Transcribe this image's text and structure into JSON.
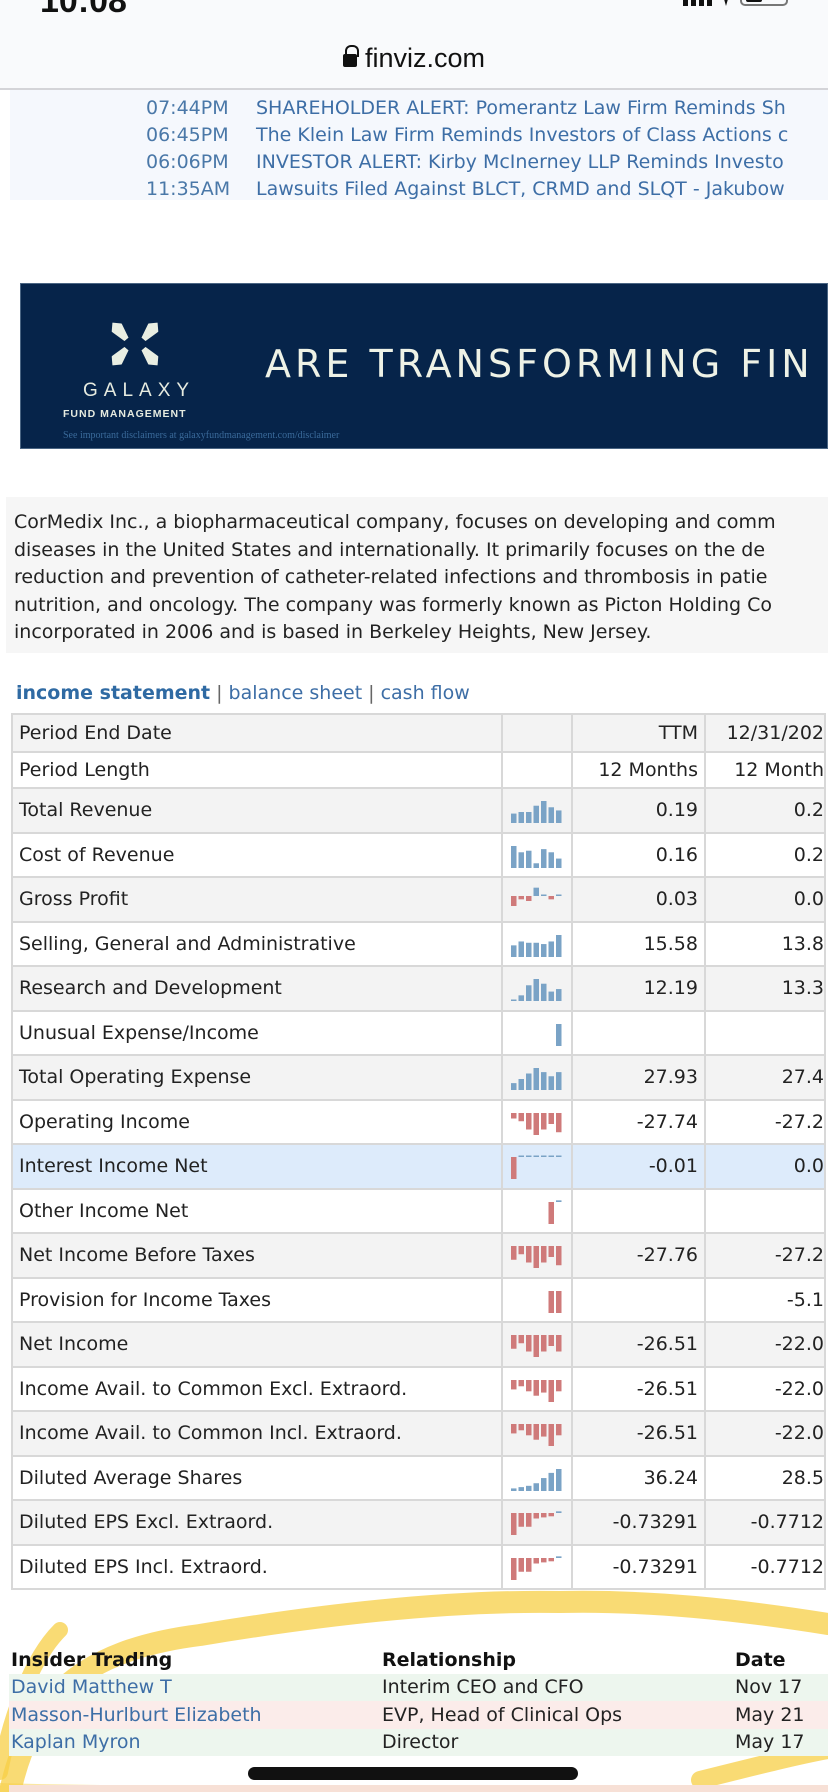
{
  "browser": {
    "url": "finviz.com"
  },
  "news": [
    {
      "time": "07:44PM",
      "title": "SHAREHOLDER ALERT: Pomerantz Law Firm Reminds Sh"
    },
    {
      "time": "06:45PM",
      "title": "The Klein Law Firm Reminds Investors of Class Actions c"
    },
    {
      "time": "06:06PM",
      "title": "INVESTOR ALERT: Kirby McInerney LLP Reminds Investo"
    },
    {
      "time": "11:35AM",
      "title": "Lawsuits Filed Against BLCT, CRMD and SLQT - Jakubow"
    }
  ],
  "ad": {
    "brand": "GALAXY",
    "sub": "FUND MANAGEMENT",
    "headline": "ARE TRANSFORMING FIN",
    "disclaimer": "See important disclaimers at galaxyfundmanagement.com/disclaimer",
    "background": "#06244a"
  },
  "description": [
    "CorMedix Inc., a biopharmaceutical company, focuses on developing and comm",
    "diseases in the United States and internationally. It primarily focuses on the de",
    "reduction and prevention of catheter-related infections and thrombosis in patie",
    "nutrition, and oncology. The company was formerly known as Picton Holding Co",
    "incorporated in 2006 and is based in Berkeley Heights, New Jersey."
  ],
  "statement_tabs": {
    "active": "income statement",
    "others": [
      "balance sheet",
      "cash flow"
    ],
    "separator": "|"
  },
  "financials": {
    "colors": {
      "positive": "#7aa3c6",
      "negative": "#cf7a7a"
    },
    "header": {
      "label": "Period End Date",
      "col1": "TTM",
      "col2": "12/31/202"
    },
    "period": {
      "label": "Period Length",
      "col1": "12 Months",
      "col2": "12 Month"
    },
    "rows": [
      {
        "label": "Total Revenue",
        "ttm": "0.19",
        "prev": "0.2",
        "spark": [
          3,
          3.5,
          3.5,
          5.5,
          7,
          5,
          4
        ]
      },
      {
        "label": "Cost of Revenue",
        "ttm": "0.16",
        "prev": "0.2",
        "spark": [
          7,
          5,
          5.5,
          1.5,
          6,
          5,
          3
        ]
      },
      {
        "label": "Gross Profit",
        "ttm": "0.03",
        "prev": "0.0",
        "spark": [
          -3,
          -1,
          -1.5,
          2.5,
          0.3,
          -1,
          0.3
        ]
      },
      {
        "label": "Selling, General and Administrative",
        "ttm": "15.58",
        "prev": "13.8",
        "spark": [
          4.5,
          6,
          5.5,
          5.5,
          5,
          6,
          8.5
        ]
      },
      {
        "label": "Research and Development",
        "ttm": "12.19",
        "prev": "13.3",
        "spark": [
          0.3,
          1.8,
          5,
          7,
          5.5,
          3,
          3.8
        ]
      },
      {
        "label": "Unusual Expense/Income",
        "ttm": "",
        "prev": "",
        "spark": [
          8
        ]
      },
      {
        "label": "Total Operating Expense",
        "ttm": "27.93",
        "prev": "27.4",
        "spark": [
          2.5,
          4,
          6,
          8,
          6.5,
          5,
          6.5
        ]
      },
      {
        "label": "Operating Income",
        "ttm": "-27.74",
        "prev": "-27.2",
        "spark": [
          -1,
          -1.5,
          -3,
          -4,
          -3,
          -2,
          -3.5
        ]
      },
      {
        "label": "Interest Income Net",
        "ttm": "-0.01",
        "prev": "0.0",
        "spark": [
          -4,
          0.2,
          0.2,
          0.2,
          0.2,
          0.2,
          0.2
        ]
      },
      {
        "label": "Other Income Net",
        "ttm": "",
        "prev": "",
        "spark": [
          null,
          -4,
          0.3
        ]
      },
      {
        "label": "Net Income Before Taxes",
        "ttm": "-27.76",
        "prev": "-27.2",
        "spark": [
          -2.5,
          -1.5,
          -3,
          -4,
          -3,
          -2,
          -3.5
        ]
      },
      {
        "label": "Provision for Income Taxes",
        "ttm": "",
        "prev": "-5.1",
        "spark": [
          null,
          null,
          null,
          null,
          null,
          -4,
          -4
        ]
      },
      {
        "label": "Net Income",
        "ttm": "-26.51",
        "prev": "-22.0",
        "spark": [
          -2.5,
          -1.5,
          -3,
          -4,
          -3,
          -2,
          -3
        ]
      },
      {
        "label": "Income Avail. to Common Excl. Extraord.",
        "ttm": "-26.51",
        "prev": "-22.0",
        "spark": [
          -1.5,
          -1,
          -1.8,
          -2.5,
          -2,
          -3.5,
          -1.8
        ]
      },
      {
        "label": "Income Avail. to Common Incl. Extraord.",
        "ttm": "-26.51",
        "prev": "-22.0",
        "spark": [
          -1.5,
          -1,
          -1.8,
          -2.5,
          -2,
          -3.5,
          -1.8
        ]
      },
      {
        "label": "Diluted Average Shares",
        "ttm": "36.24",
        "prev": "28.5",
        "spark": [
          1,
          1.5,
          2,
          3,
          5,
          7,
          8.5
        ]
      },
      {
        "label": "Diluted EPS Excl. Extraord.",
        "ttm": "-0.73291",
        "prev": "-0.7712",
        "spark": [
          -4,
          -2.5,
          -2.5,
          -1,
          -0.8,
          -0.6,
          0.3
        ]
      },
      {
        "label": "Diluted EPS Incl. Extraord.",
        "ttm": "-0.73291",
        "prev": "-0.7712",
        "spark": [
          -4,
          -2.5,
          -2.5,
          -1,
          -0.8,
          -0.6,
          0.3
        ]
      }
    ]
  },
  "insider": {
    "headers": {
      "name": "Insider Trading",
      "relationship": "Relationship",
      "date": "Date"
    },
    "rows": [
      {
        "name": "David Matthew T",
        "relationship": "Interim CEO and CFO",
        "date": "Nov 17",
        "type": "buy"
      },
      {
        "name": "Masson-Hurlburt Elizabeth",
        "relationship": "EVP, Head of Clinical Ops",
        "date": "May 21",
        "type": "sell"
      },
      {
        "name": "Kaplan Myron",
        "relationship": "Director",
        "date": "May 17",
        "type": "buy"
      }
    ]
  }
}
